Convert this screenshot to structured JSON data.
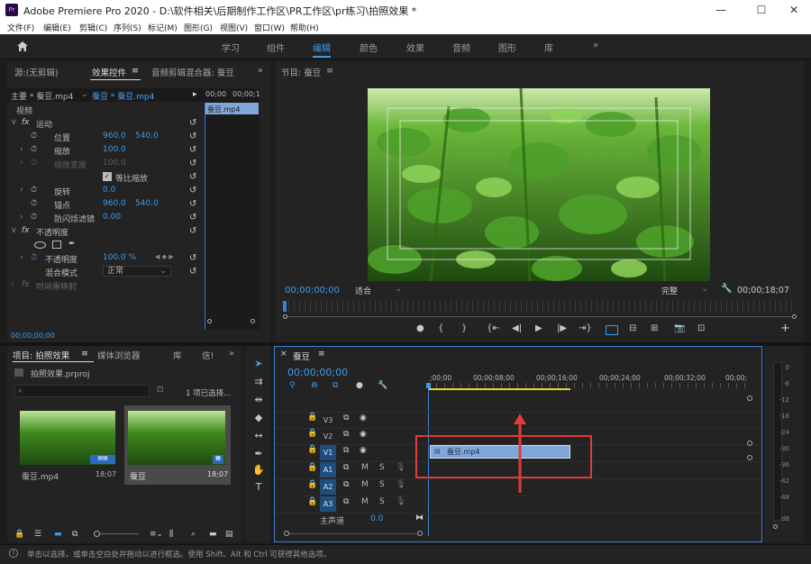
{
  "window": {
    "logo": "Pr",
    "title": "Adobe Premiere Pro 2020 - D:\\软件相关\\后期制作工作区\\PR工作区\\pr练习\\拍照效果 *",
    "min": "—",
    "max": "☐",
    "close": "✕"
  },
  "menu": [
    "文件(F)",
    "编辑(E)",
    "剪辑(C)",
    "序列(S)",
    "标记(M)",
    "图形(G)",
    "视图(V)",
    "窗口(W)",
    "帮助(H)"
  ],
  "workspaces": {
    "home_icon": "home-icon",
    "tabs": [
      "学习",
      "组件",
      "编辑",
      "颜色",
      "效果",
      "音频",
      "图形",
      "库"
    ],
    "active": "编辑",
    "more": "»"
  },
  "source_panel": {
    "tabs": [
      "源:(无剪辑)",
      "效果控件",
      "音频剪辑混合器: 蚕豆"
    ],
    "menu": "≡",
    "more": "»"
  },
  "effect_controls": {
    "master": "主要 * 蚕豆.mp4",
    "clip": "蚕豆 * 蚕豆.mp4",
    "mini_time1": "00;00",
    "mini_time2": "00;00;1",
    "mini_clip": "蚕豆.mp4",
    "video_header": "视频",
    "motion": "运动",
    "position_label": "位置",
    "position_x": "960.0",
    "position_y": "540.0",
    "scale_label": "缩放",
    "scale_val": "100.0",
    "scale_width_label": "缩放宽度",
    "scale_width_val": "100.0",
    "uniform_label": "等比缩放",
    "rotation_label": "旋转",
    "rotation_val": "0.0",
    "anchor_label": "锚点",
    "anchor_x": "960.0",
    "anchor_y": "540.0",
    "flicker_label": "防闪烁滤镜",
    "flicker_val": "0.00",
    "opacity_header": "不透明度",
    "opacity_label": "不透明度",
    "opacity_val": "100.0 %",
    "blend_label": "混合模式",
    "blend_val": "正常",
    "timeremap_label": "时间重映射",
    "timecode": "00;00;00;00"
  },
  "program": {
    "title": "节目: 蚕豆",
    "menu": "≡",
    "timecode": "00;00;00;00",
    "zoom": "适合",
    "quality": "完整",
    "duration": "00;00;18;07"
  },
  "project": {
    "tabs": [
      "项目: 拍照效果",
      "媒体浏览器",
      "库",
      "信!"
    ],
    "menu": "≡",
    "more": "»",
    "file": "拍照效果.prproj",
    "selection": "1 项已选择...",
    "items": [
      {
        "name": "蚕豆.mp4",
        "dur": "18;07"
      },
      {
        "name": "蚕豆",
        "dur": "18;07"
      }
    ]
  },
  "timeline": {
    "close": "×",
    "title": "蚕豆",
    "menu": "≡",
    "timecode": "00;00;00;00",
    "ruler": [
      ";00;00",
      "00;00;08;00",
      "00;00;16;00",
      "00;00;24;00",
      "00;00;32;00",
      "00;00;"
    ],
    "video_tracks": [
      "V3",
      "V2",
      "V1"
    ],
    "audio_tracks": [
      "A1",
      "A2",
      "A3"
    ],
    "clip": "蚕豆.mp4",
    "master_label": "主声道",
    "master_val": "0.0",
    "mute": "M",
    "solo": "S"
  },
  "meters": {
    "labels": [
      "0",
      "-6",
      "-12",
      "-18",
      "-24",
      "-30",
      "-36",
      "-42",
      "-48",
      "dB"
    ]
  },
  "status": "单击以选择，或单击空白处并拖动以进行框选。使用 Shift、Alt 和 Ctrl 可获得其他选项。",
  "colors": {
    "accent": "#3d9be9",
    "clip": "#7fa8d8",
    "highlight": "#e23b3b",
    "playhead": "#3d7fd6"
  }
}
